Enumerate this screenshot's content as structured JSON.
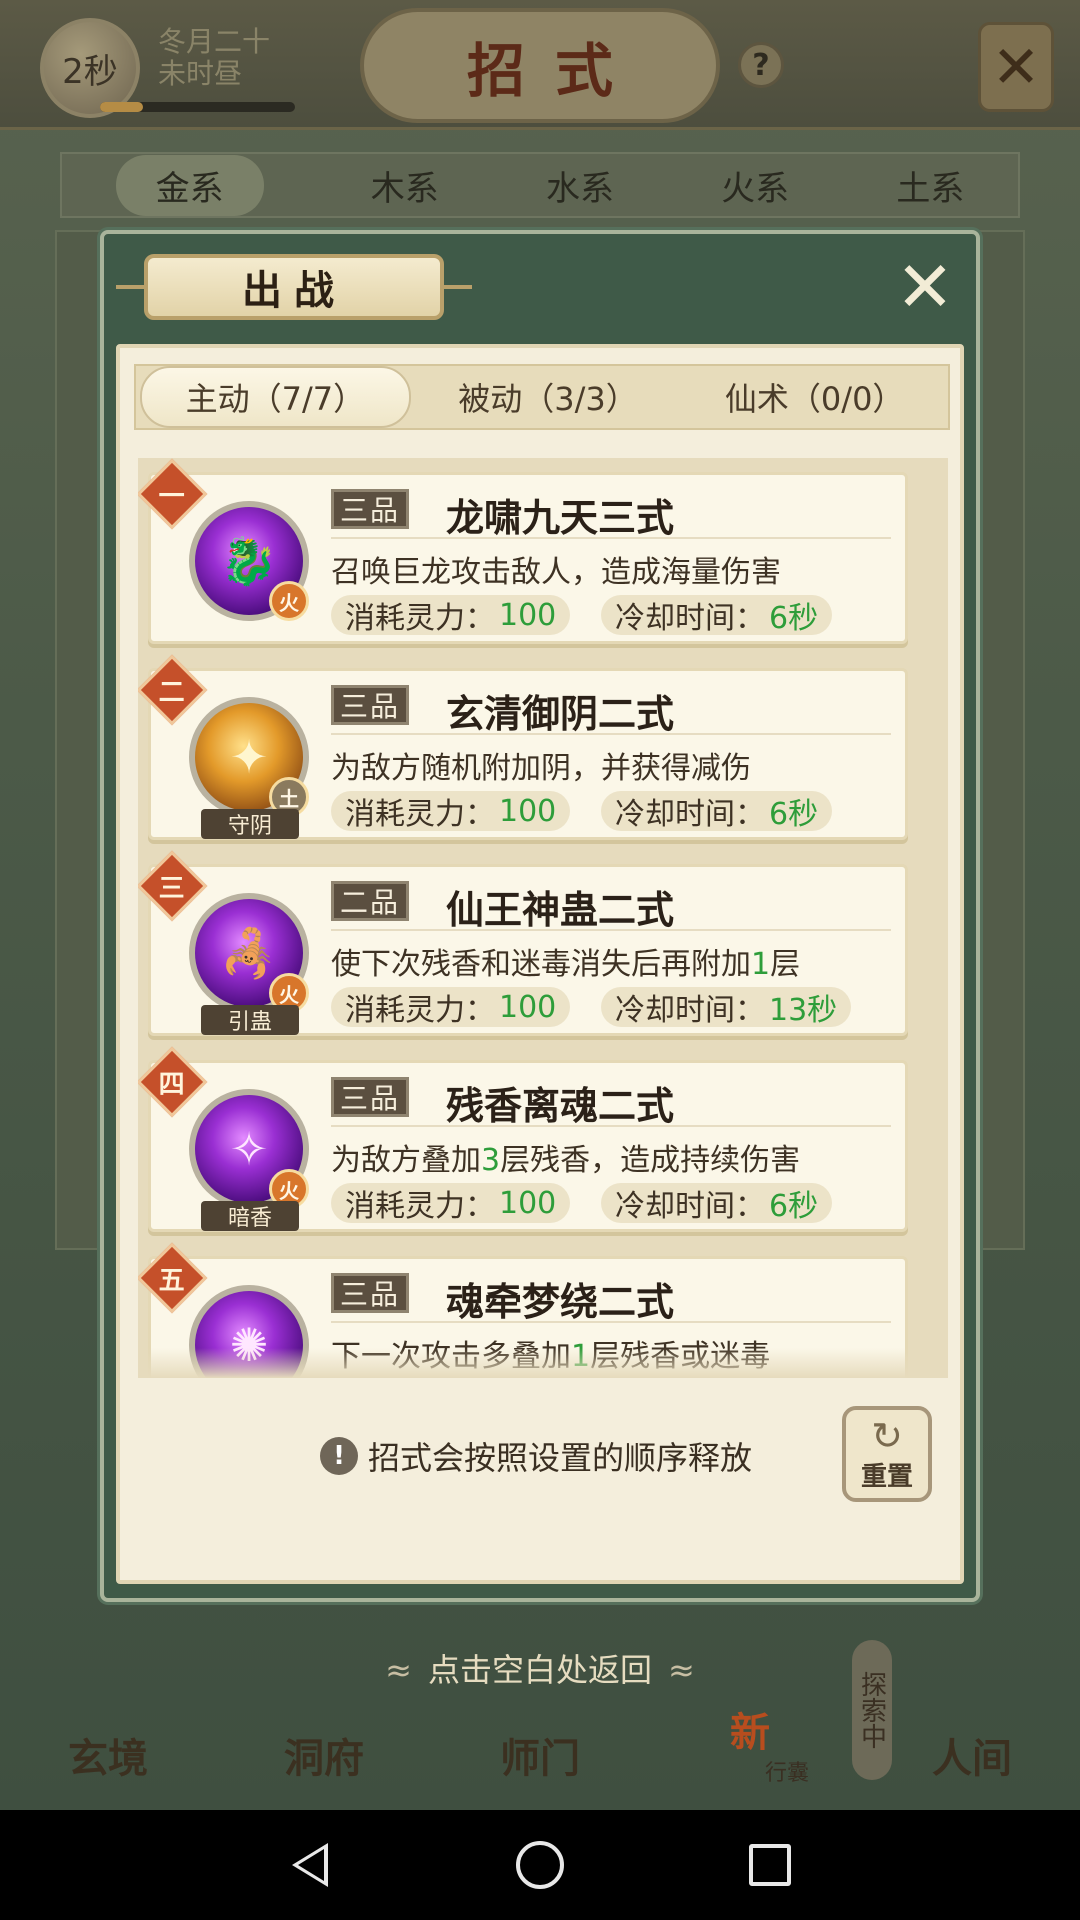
{
  "hud": {
    "timer": "2秒",
    "date_line1": "冬月二十",
    "date_line2": "未时昼",
    "page_title": "招式",
    "help_icon": "?",
    "close_icon": "✕"
  },
  "element_tabs": [
    "金系",
    "木系",
    "水系",
    "火系",
    "土系"
  ],
  "dialog": {
    "title": "出战",
    "close_icon": "✕",
    "sub_tabs": [
      {
        "label": "主动（7/7）",
        "active": true
      },
      {
        "label": "被动（3/3）",
        "active": false
      },
      {
        "label": "仙术（0/0）",
        "active": false
      }
    ],
    "skills": [
      {
        "order": "一",
        "grade": "三品",
        "name": "龙啸九天三式",
        "desc": "召唤巨龙攻击敌人，造成海量伤害",
        "badge": "火",
        "tag": "",
        "cost_label": "消耗灵力：",
        "cost_value": "100",
        "cd_label": "冷却时间：",
        "cd_value": "6秒",
        "icon": "dragon-icon"
      },
      {
        "order": "二",
        "grade": "三品",
        "name": "玄清御阴二式",
        "desc": "为敌方随机附加阴，并获得减伤",
        "badge": "土",
        "tag": "守阴",
        "cost_label": "消耗灵力：",
        "cost_value": "100",
        "cd_label": "冷却时间：",
        "cd_value": "6秒",
        "icon": "ruyi-icon"
      },
      {
        "order": "三",
        "grade": "二品",
        "name": "仙王神蛊二式",
        "desc_pre": "使下次残香和迷毒消失后再附加",
        "desc_hl": "1",
        "desc_post": "层",
        "badge": "火",
        "tag": "引蛊",
        "cost_label": "消耗灵力：",
        "cost_value": "100",
        "cd_label": "冷却时间：",
        "cd_value": "13秒",
        "icon": "scorpion-icon"
      },
      {
        "order": "四",
        "grade": "三品",
        "name": "残香离魂二式",
        "desc_pre": "为敌方叠加",
        "desc_hl": "3",
        "desc_post": "层残香，造成持续伤害",
        "badge": "火",
        "tag": "暗香",
        "cost_label": "消耗灵力：",
        "cost_value": "100",
        "cd_label": "冷却时间：",
        "cd_value": "6秒",
        "icon": "ghost-icon"
      },
      {
        "order": "五",
        "grade": "三品",
        "name": "魂牵梦绕二式",
        "desc_pre": "下一次攻击多叠加",
        "desc_hl": "1",
        "desc_post": "层残香或迷毒",
        "icon": "vortex-icon"
      }
    ],
    "hint": "招式会按照设置的顺序释放",
    "reset_label": "重置"
  },
  "bottom": {
    "tap_hint": "点击空白处返回",
    "nav": [
      "玄境",
      "洞府",
      "师门",
      "",
      "人间"
    ],
    "new_badge": "新",
    "bag_label": "行囊",
    "explore_label": "探索中"
  },
  "colors": {
    "accent_green": "#2e9d3a",
    "order_red": "#c5502a",
    "dialog_green": "#3f5a48"
  }
}
